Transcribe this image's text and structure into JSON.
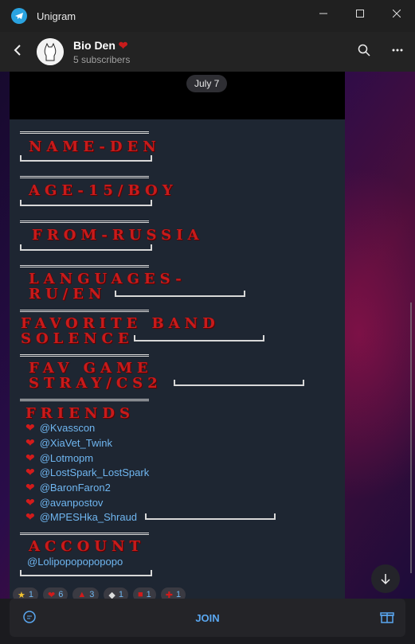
{
  "window": {
    "title": "Unigram"
  },
  "header": {
    "channel_name": "Bio Den",
    "subscribers": "5 subscribers"
  },
  "date_pill": "July 7",
  "bio": {
    "name": "NAME-DEN",
    "age": "AGE-15/BOY",
    "from": "FROM-RUSSIA",
    "languages": [
      "LANGUAGES-",
      "RU/EN"
    ],
    "band": [
      "FAVORITE BAND",
      "SOLENCE"
    ],
    "game": [
      "FAV GAME",
      "STRAY/CS2"
    ],
    "friends_title": "FRIENDS",
    "friends": [
      "@Kvasscon",
      "@XiaVet_Twink",
      "@Lotmopm",
      "@LostSpark_LostSpark",
      "@BaronFaron2",
      "@avanpostov",
      "@MPESHka_Shraud"
    ],
    "account_title": "ACCOUNT",
    "account": "@Lolipopopopopopo"
  },
  "reactions": [
    {
      "icon": "star-icon",
      "count": "1"
    },
    {
      "icon": "heart-icon",
      "count": "6"
    },
    {
      "icon": "chart-icon",
      "count": "3"
    },
    {
      "icon": "rat-icon",
      "count": "1"
    },
    {
      "icon": "ticket-icon",
      "count": "1"
    },
    {
      "icon": "plus-icon",
      "count": "1"
    }
  ],
  "bottombar": {
    "join_label": "JOIN"
  },
  "colors": {
    "accent": "#5aa7f0",
    "blood": "#c81b1b",
    "bubble": "#1e2632"
  }
}
